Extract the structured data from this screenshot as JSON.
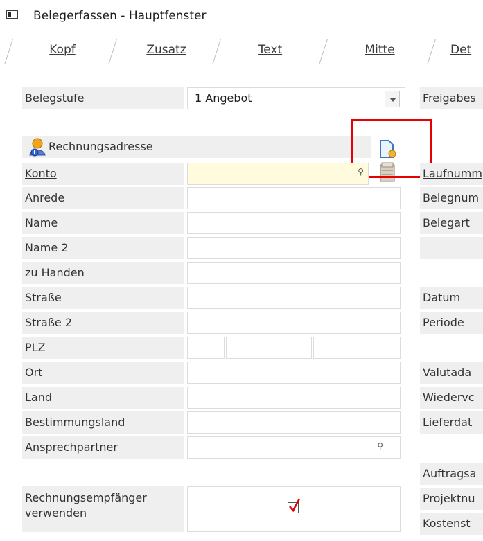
{
  "window": {
    "title": "Belegerfassen - Hauptfenster"
  },
  "tabs": [
    {
      "label": "Kopf"
    },
    {
      "label": "Zusatz"
    },
    {
      "label": "Text"
    },
    {
      "label": "Mitte"
    },
    {
      "label": "Det"
    }
  ],
  "belegstufe": {
    "label": "Belegstufe",
    "value": "1 Angebot"
  },
  "freigabe": {
    "label": "Freigabes"
  },
  "rechnungsadresse": {
    "header": "Rechnungsadresse"
  },
  "left_fields": [
    {
      "label": "Konto"
    },
    {
      "label": "Anrede"
    },
    {
      "label": "Name"
    },
    {
      "label": "Name 2"
    },
    {
      "label": "zu Handen"
    },
    {
      "label": "Straße"
    },
    {
      "label": "Straße 2"
    },
    {
      "label": "PLZ"
    },
    {
      "label": "Ort"
    },
    {
      "label": "Land"
    },
    {
      "label": "Bestimmungsland"
    },
    {
      "label": "Ansprechpartner"
    }
  ],
  "rechnungsempfaenger": {
    "line1": "Rechnungsempfänger",
    "line2": "verwenden",
    "checked": true
  },
  "right_labels": {
    "laufnummer": "Laufnumm",
    "belegnummer": "Belegnum",
    "belegart": "Belegart",
    "datum": "Datum",
    "periode": "Periode",
    "valutadatum": "Valutada",
    "wiedervorlage": "Wiedervc",
    "lieferdatum": "Lieferdat",
    "auftrag": "Auftragsa",
    "projekt": "Projektnu",
    "kostenstelle": "Kostenst"
  },
  "colors": {
    "konto_bg": "#fffbdc",
    "label_bg": "#efefef",
    "highlight": "#e60000"
  }
}
